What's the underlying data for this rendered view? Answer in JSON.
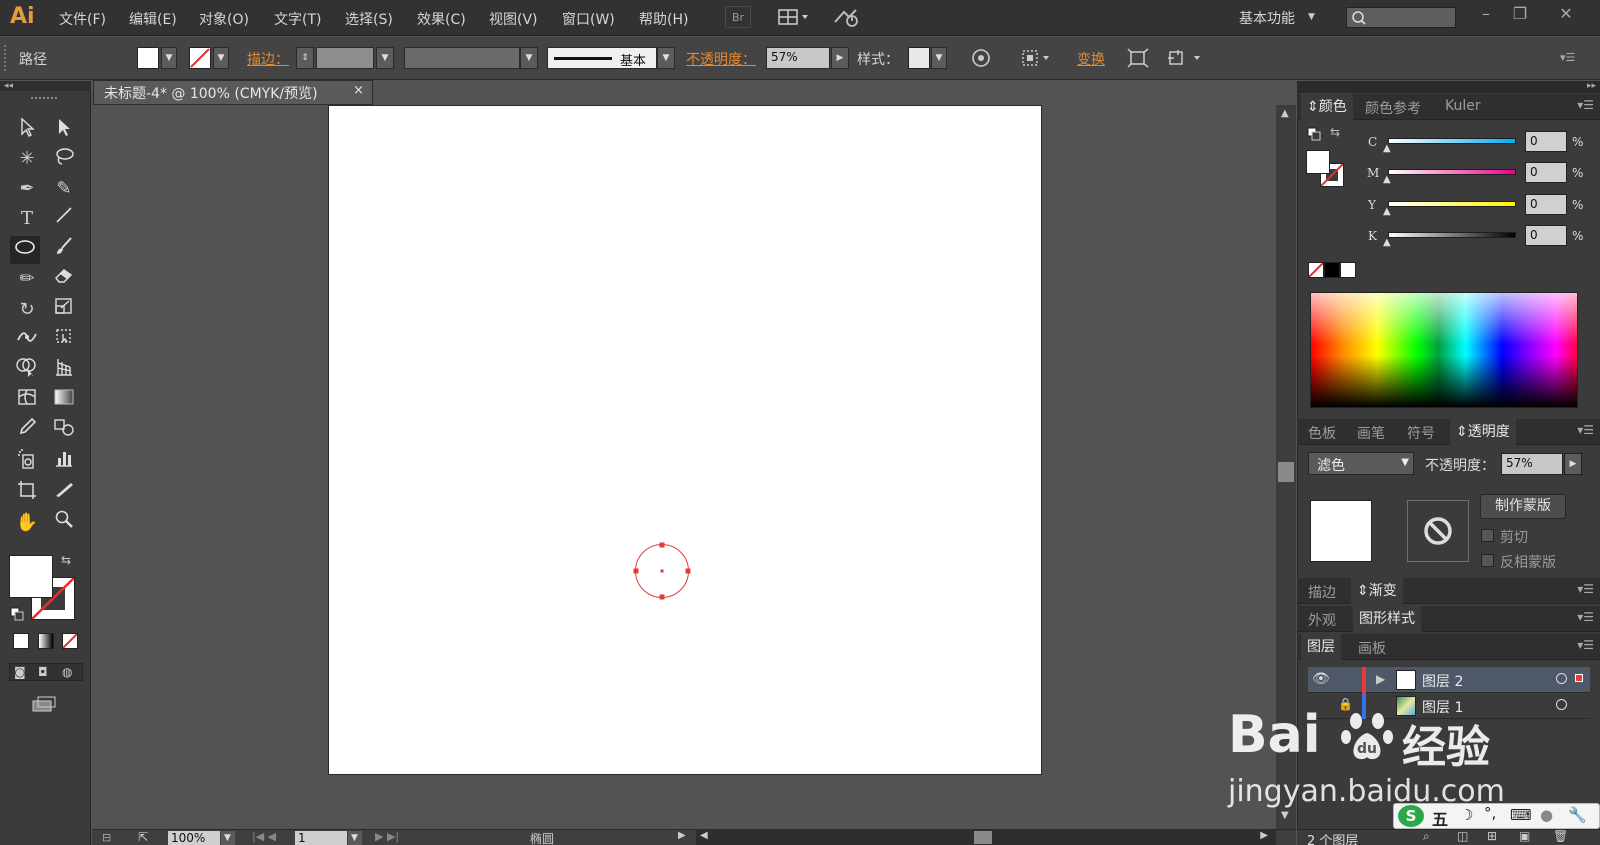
{
  "app": {
    "logo": "Ai"
  },
  "menu": {
    "items": [
      "文件(F)",
      "编辑(E)",
      "对象(O)",
      "文字(T)",
      "选择(S)",
      "效果(C)",
      "视图(V)",
      "窗口(W)",
      "帮助(H)"
    ],
    "bridge_label": "Br",
    "workspace": "基本功能",
    "search_placeholder": ""
  },
  "control_bar": {
    "selection_type": "路径",
    "stroke_label": "描边：",
    "stroke_profile": "基本",
    "opacity_label": "不透明度：",
    "opacity_value": "57%",
    "style_label": "样式：",
    "transform_label": "变换"
  },
  "document": {
    "tab_title": "未标题-4* @ 100% (CMYK/预览)",
    "tab_close": "×"
  },
  "status_bar": {
    "zoom": "100%",
    "artboard_number": "1",
    "current_tool": "椭圆",
    "layer_count": "2 个图层"
  },
  "color_panel": {
    "tabs": [
      "颜色",
      "颜色参考",
      "Kuler"
    ],
    "channels": [
      {
        "label": "C",
        "value": "0",
        "unit": "%",
        "colors": [
          "#ffffff",
          "#00aeef"
        ]
      },
      {
        "label": "M",
        "value": "0",
        "unit": "%",
        "colors": [
          "#ffffff",
          "#ec008c"
        ]
      },
      {
        "label": "Y",
        "value": "0",
        "unit": "%",
        "colors": [
          "#ffffff",
          "#fff200"
        ]
      },
      {
        "label": "K",
        "value": "0",
        "unit": "%",
        "colors": [
          "#ffffff",
          "#000000"
        ]
      }
    ]
  },
  "transparency_panel": {
    "tabs": [
      "色板",
      "画笔",
      "符号",
      "透明度"
    ],
    "blend_mode": "滤色",
    "opacity_label": "不透明度：",
    "opacity_value": "57%",
    "make_mask_button": "制作蒙版",
    "clip_label": "剪切",
    "invert_mask_label": "反相蒙版"
  },
  "stroke_tabs": [
    "描边",
    "渐变"
  ],
  "appearance_tabs": [
    "外观",
    "图形样式"
  ],
  "layers_panel": {
    "tabs": [
      "图层",
      "画板"
    ],
    "layers": [
      {
        "name": "图层 2",
        "color": "#e83a3a",
        "selected": true
      },
      {
        "name": "图层 1",
        "color": "#3a6fe8",
        "selected": false
      }
    ]
  },
  "watermark": {
    "brand": "Bai",
    "brand2": "经验",
    "url": "jingyan.baidu.com"
  },
  "ime": {
    "label": "五"
  },
  "colors": {
    "accent_orange": "#e6892d",
    "selection_red": "#e03c3c"
  }
}
